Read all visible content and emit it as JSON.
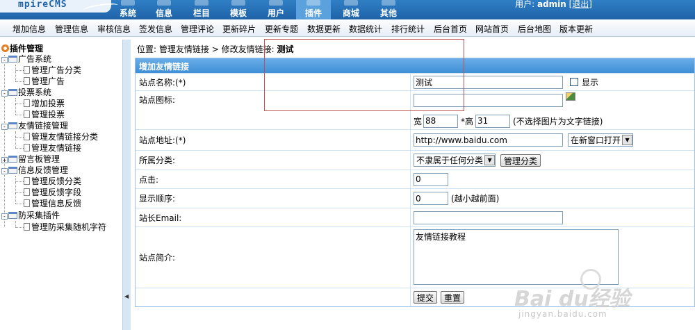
{
  "header": {
    "logo": "mpireCMS",
    "menu": [
      {
        "label": "系统"
      },
      {
        "label": "信息"
      },
      {
        "label": "栏目"
      },
      {
        "label": "模板"
      },
      {
        "label": "用户"
      },
      {
        "label": "插件"
      },
      {
        "label": "商城"
      },
      {
        "label": "其他"
      }
    ],
    "active_menu": "插件",
    "user_prefix": "用户:",
    "username": "admin",
    "logout": "[退出]"
  },
  "subnav": [
    "增加信息",
    "管理信息",
    "审核信息",
    "签发信息",
    "管理评论",
    "更新碎片",
    "更新专题",
    "数据更新",
    "数据统计",
    "排行统计",
    "后台首页",
    "网站首页",
    "后台地图",
    "版本更新"
  ],
  "sidebar": {
    "root": "插件管理",
    "groups": [
      {
        "label": "广告系统",
        "items": [
          "管理广告分类",
          "管理广告"
        ]
      },
      {
        "label": "投票系统",
        "items": [
          "增加投票",
          "管理投票"
        ]
      },
      {
        "label": "友情链接管理",
        "items": [
          "管理友情链接分类",
          "管理友情链接"
        ]
      },
      {
        "label": "留言板管理",
        "items": []
      },
      {
        "label": "信息反馈管理",
        "items": [
          "管理反馈分类",
          "管理反馈字段",
          "管理信息反馈"
        ]
      },
      {
        "label": "防采集插件",
        "items": [
          "管理防采集随机字符"
        ]
      }
    ]
  },
  "breadcrumb": {
    "prefix": "位置:",
    "link1": "管理友情链接",
    "sep": ">",
    "link2": "修改友情链接:",
    "current": "测试"
  },
  "form": {
    "title": "增加友情链接",
    "site_name_label": "站点名称:(*)",
    "site_name_value": "测试",
    "show_label": "显示",
    "site_icon_label": "站点图标:",
    "site_icon_value": "",
    "width_label": "宽",
    "width_value": "88",
    "height_label": "*高",
    "height_value": "31",
    "size_hint": "(不选择图片为文字链接)",
    "site_url_label": "站点地址:(*)",
    "site_url_value": "http://www.baidu.com",
    "open_mode": "在新窗口打开",
    "category_label": "所属分类:",
    "category_value": "不隶属于任何分类",
    "manage_category_btn": "管理分类",
    "clicks_label": "点击:",
    "clicks_value": "0",
    "order_label": "显示顺序:",
    "order_value": "0",
    "order_hint": "(越小越前面)",
    "email_label": "站长Email:",
    "email_value": "",
    "intro_label": "站点简介:",
    "intro_value": "友情链接教程",
    "submit_btn": "提交",
    "reset_btn": "重置"
  },
  "watermark": {
    "brand": "Bai du经验",
    "url": "jingyan.baidu.com"
  }
}
